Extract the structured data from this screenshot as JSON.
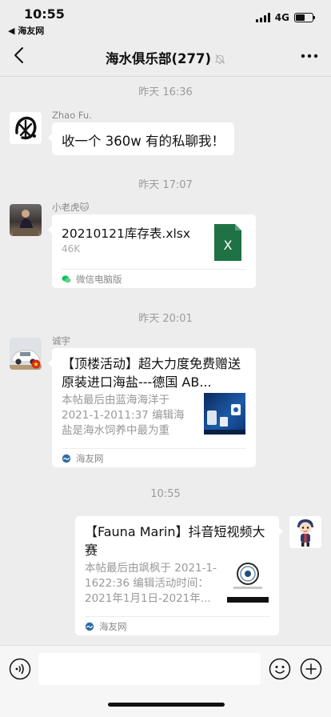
{
  "status": {
    "time": "10:55",
    "back_app": "◀ 海友网",
    "network": "4G"
  },
  "nav": {
    "title": "海水俱乐部(277)"
  },
  "messages": [
    {
      "timestamp": "昨天 16:36",
      "sender": "Zhao Fu.",
      "text": "收一个 360w 有的私聊我！"
    },
    {
      "timestamp": "昨天 17:07",
      "sender": "小老虎🐱",
      "file_name": "20210121库存表.xlsx",
      "file_size": "46K",
      "source": "微信电脑版"
    },
    {
      "timestamp": "昨天 20:01",
      "sender": "诚宇",
      "title": "【顶楼活动】超大力度免费赠送原装进口海盐---德国 AB...",
      "desc": "本帖最后由蓝海海洋于 2021-1-2011:37 编辑海盐是海水饲养中最为重要...",
      "source": "海友网"
    },
    {
      "timestamp": "10:55",
      "title": "【Fauna Marin】抖音短视频大赛",
      "desc": "本帖最后由飒枫于 2021-1-1622:36 编辑活动时间：2021年1月1日-2021年...",
      "source": "海友网"
    }
  ],
  "colors": {
    "background": "#ededed",
    "excel_green": "#1f7244",
    "wechat_green": "#07c160"
  }
}
